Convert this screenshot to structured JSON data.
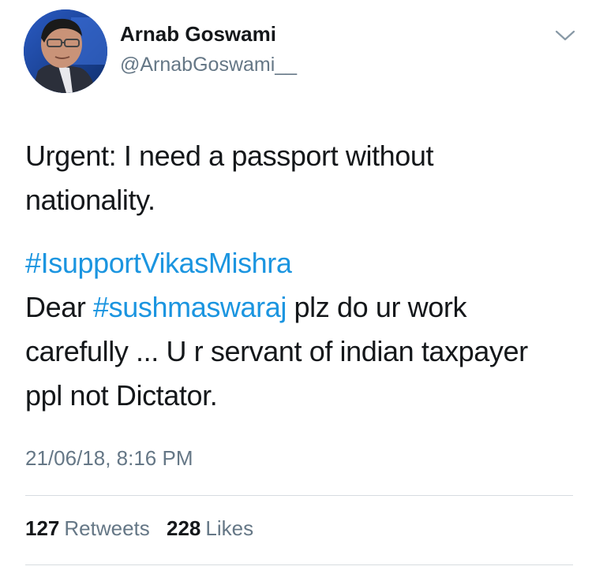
{
  "author": {
    "name": "Arnab Goswami",
    "handle": "@ArnabGoswami__"
  },
  "tweet": {
    "line1": "Urgent: I need a passport without nationality.",
    "hashtag1": "#IsupportVikasMishra",
    "line2_pre": "Dear ",
    "hashtag2": "#sushmaswaraj",
    "line2_post": " plz do ur work carefully ... U r servant of indian taxpayer ppl not Dictator.",
    "timestamp": "21/06/18, 8:16 PM"
  },
  "stats": {
    "retweets_count": "127",
    "retweets_label": "Retweets",
    "likes_count": "228",
    "likes_label": "Likes"
  },
  "icons": {
    "menu": "chevron-down-icon"
  },
  "colors": {
    "link": "#1b95e0",
    "secondary_text": "#657786",
    "primary_text": "#14171a"
  }
}
